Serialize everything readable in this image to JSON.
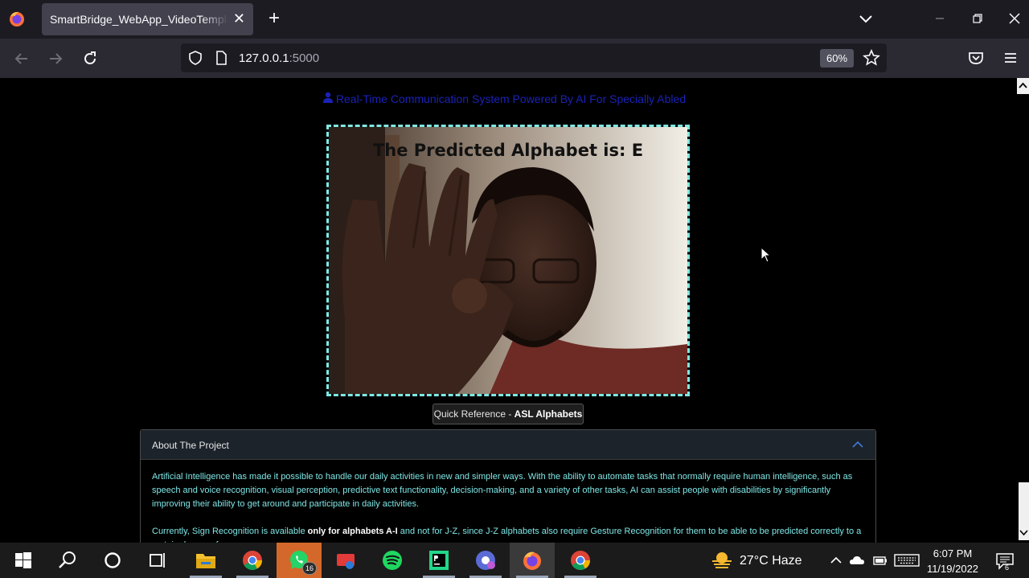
{
  "browser": {
    "tab_title": "SmartBridge_WebApp_VideoTemplate",
    "tab_close": "✕",
    "new_tab": "+",
    "url_host": "127.0.0.1",
    "url_port": ":5000",
    "zoom": "60%"
  },
  "page": {
    "heading": "Real-Time Communication System Powered By AI For Specially Abled",
    "prediction_text": "The Predicted Alphabet is: E",
    "quick_ref_prefix": "Quick Reference - ",
    "quick_ref_bold": "ASL Alphabets",
    "accordion": {
      "title": "About The Project",
      "para1": "Artificial Intelligence has made it possible to handle our daily activities in new and simpler ways. With the ability to automate tasks that normally require human intelligence, such as speech and voice recognition, visual perception, predictive text functionality, decision-making, and a variety of other tasks, AI can assist people with disabilities by significantly improving their ability to get around and participate in daily activities.",
      "para2_pre": "Currently, Sign Recognition is available ",
      "para2_bold": "only for alphabets A-I",
      "para2_post": " and not for J-Z, since J-Z alphabets also require Gesture Recognition for them to be able to be predicted correctly to a certain degree of accuracy."
    }
  },
  "taskbar": {
    "whatsapp_badge": "16",
    "weather": "27°C  Haze",
    "time": "6:07 PM",
    "date": "11/19/2022",
    "notifications": "6"
  },
  "colors": {
    "accent_cyan": "#7fe9e4",
    "heading_blue": "#1a22b8",
    "tab_bg": "#42414d",
    "chrome_bg": "#1c1b22"
  }
}
